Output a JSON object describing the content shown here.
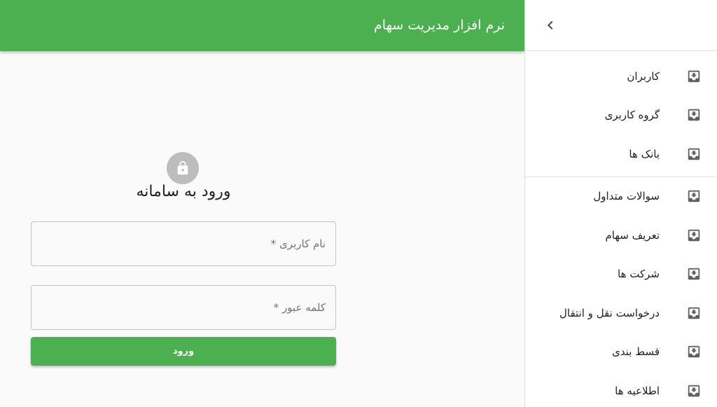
{
  "appbar": {
    "title": "نرم افزار مدیریت سهام"
  },
  "colors": {
    "primary": "#4caf50",
    "avatar": "#bdbdbd",
    "icon": "#616161"
  },
  "drawer": {
    "toggle_icon": "chevron-left-icon",
    "groups": [
      [
        {
          "label": "کاربران",
          "icon": "move-to-inbox-icon"
        },
        {
          "label": "گروه کاربری",
          "icon": "move-to-inbox-icon"
        },
        {
          "label": "بانک ها",
          "icon": "move-to-inbox-icon"
        }
      ],
      [
        {
          "label": "سوالات متداول",
          "icon": "move-to-inbox-icon"
        },
        {
          "label": "تعریف سهام",
          "icon": "move-to-inbox-icon"
        },
        {
          "label": "شرکت ها",
          "icon": "move-to-inbox-icon"
        },
        {
          "label": "درخواست نقل و انتقال",
          "icon": "move-to-inbox-icon"
        },
        {
          "label": "قسط بندی",
          "icon": "move-to-inbox-icon"
        },
        {
          "label": "اطلاعیه ها",
          "icon": "move-to-inbox-icon"
        }
      ]
    ]
  },
  "login": {
    "icon": "lock-icon",
    "title": "ورود به سامانه",
    "username_placeholder": "نام کاربری *",
    "username_value": "",
    "password_placeholder": "کلمه عبور *",
    "password_value": "",
    "submit_label": "ورود"
  }
}
